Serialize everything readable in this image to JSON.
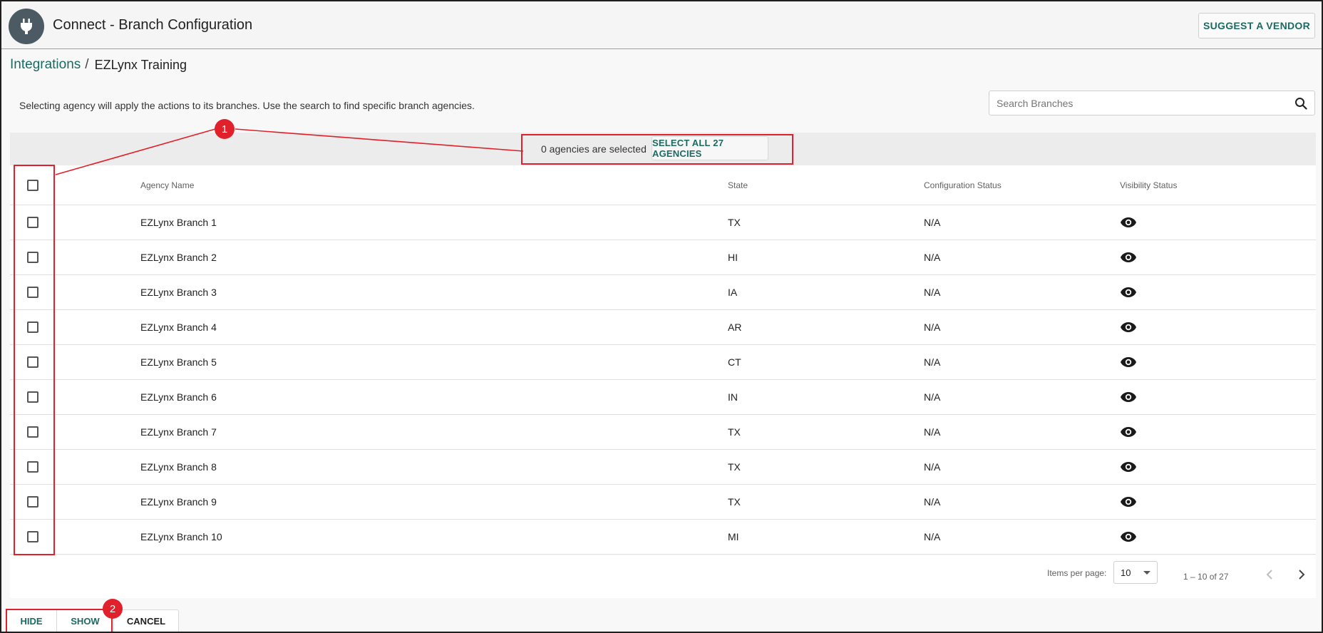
{
  "header": {
    "title": "Connect - Branch Configuration",
    "suggest_label": "SUGGEST A VENDOR",
    "logo_icon": "plug-icon"
  },
  "breadcrumb": {
    "link": "Integrations",
    "separator": "/",
    "current": "EZLynx Training"
  },
  "instruction": "Selecting agency will apply the actions to its branches. Use the search to find specific branch agencies.",
  "search": {
    "placeholder": "Search Branches",
    "icon": "search-icon"
  },
  "selection": {
    "count_text": "0 agencies are selected",
    "select_all_label": "SELECT ALL 27 AGENCIES"
  },
  "table": {
    "columns": {
      "name": "Agency Name",
      "state": "State",
      "config": "Configuration Status",
      "visibility": "Visibility Status"
    },
    "rows": [
      {
        "name": "EZLynx Branch 1",
        "state": "TX",
        "config": "N/A",
        "visibility_icon": "eye-icon"
      },
      {
        "name": "EZLynx Branch 2",
        "state": "HI",
        "config": "N/A",
        "visibility_icon": "eye-icon"
      },
      {
        "name": "EZLynx Branch 3",
        "state": "IA",
        "config": "N/A",
        "visibility_icon": "eye-icon"
      },
      {
        "name": "EZLynx Branch 4",
        "state": "AR",
        "config": "N/A",
        "visibility_icon": "eye-icon"
      },
      {
        "name": "EZLynx Branch 5",
        "state": "CT",
        "config": "N/A",
        "visibility_icon": "eye-icon"
      },
      {
        "name": "EZLynx Branch 6",
        "state": "IN",
        "config": "N/A",
        "visibility_icon": "eye-icon"
      },
      {
        "name": "EZLynx Branch 7",
        "state": "TX",
        "config": "N/A",
        "visibility_icon": "eye-icon"
      },
      {
        "name": "EZLynx Branch 8",
        "state": "TX",
        "config": "N/A",
        "visibility_icon": "eye-icon"
      },
      {
        "name": "EZLynx Branch 9",
        "state": "TX",
        "config": "N/A",
        "visibility_icon": "eye-icon"
      },
      {
        "name": "EZLynx Branch 10",
        "state": "MI",
        "config": "N/A",
        "visibility_icon": "eye-icon"
      }
    ]
  },
  "paginator": {
    "items_per_page_label": "Items per page:",
    "items_per_page": "10",
    "range": "1 – 10 of 27"
  },
  "actions": {
    "hide": "HIDE",
    "show": "SHOW",
    "cancel": "CANCEL"
  },
  "annotations": {
    "badge1": "1",
    "badge2": "2",
    "color": "#e0202a"
  },
  "colors": {
    "accent": "#1b6b63",
    "logo_bg": "#4b5a63"
  }
}
